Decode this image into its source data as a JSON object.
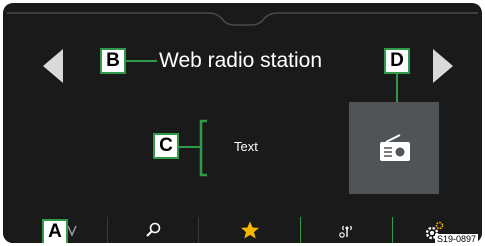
{
  "station": {
    "title": "Web radio station"
  },
  "content": {
    "text_label": "Text"
  },
  "callouts": {
    "a": "A",
    "b": "B",
    "c": "C",
    "d": "D"
  },
  "figure_id": "S19-0897",
  "colors": {
    "screen_bg": "#1a1a1a",
    "accent_green": "#2e9a4a",
    "tile_bg": "#505457",
    "favorite_star": "#f5b800",
    "settings_gear": "#f5b800"
  },
  "icons": {
    "prev": "triangle-left",
    "next": "triangle-right",
    "radio": "radio",
    "search": "magnifier",
    "favorites": "star",
    "signal": "antenna",
    "settings": "gear"
  }
}
